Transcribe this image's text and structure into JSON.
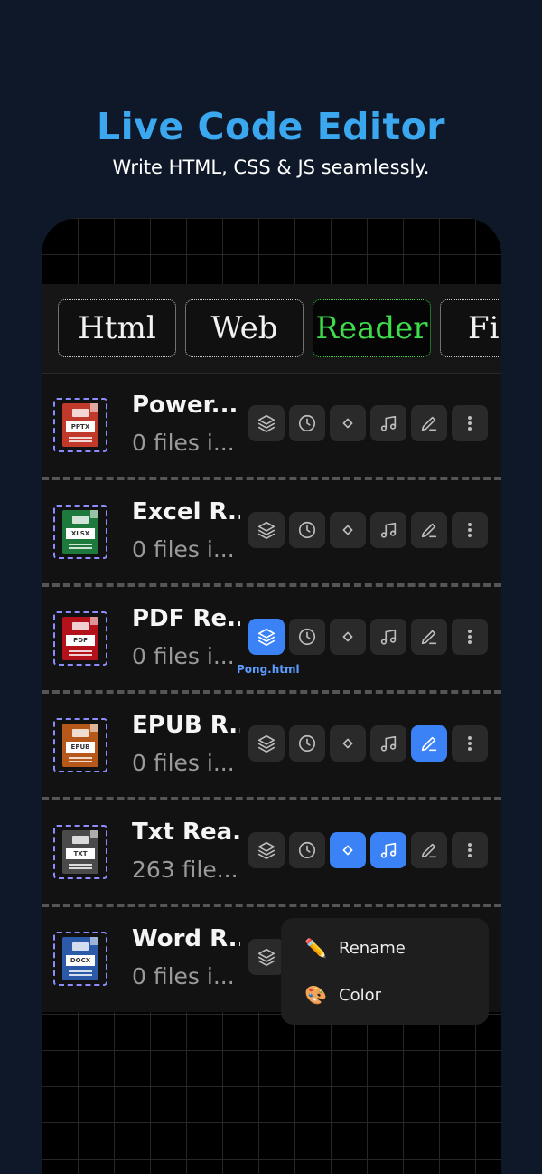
{
  "hero": {
    "title": "Live Code Editor",
    "subtitle": "Write HTML, CSS & JS seamlessly."
  },
  "tabs": [
    {
      "label": "Html",
      "active": false
    },
    {
      "label": "Web",
      "active": false
    },
    {
      "label": "Reader",
      "active": true
    },
    {
      "label": "Fi",
      "active": false
    }
  ],
  "files": [
    {
      "title": "Power...",
      "subtitle": "0 files i...",
      "icon_label": "PPTX",
      "icon_color": "#c0392b",
      "highlighted": []
    },
    {
      "title": "Excel R...",
      "subtitle": "0 files i...",
      "icon_label": "XLSX",
      "icon_color": "#1e7a3c",
      "highlighted": []
    },
    {
      "title": "PDF Re...",
      "subtitle": "0 files i...",
      "icon_label": "PDF",
      "icon_color": "#b3121b",
      "highlighted": [
        "layers"
      ],
      "caption": "Pong.html"
    },
    {
      "title": "EPUB R...",
      "subtitle": "0 files i...",
      "icon_label": "EPUB",
      "icon_color": "#b5581a",
      "highlighted": [
        "edit"
      ]
    },
    {
      "title": "Txt Rea...",
      "subtitle": "263 file...",
      "icon_label": "TXT",
      "icon_color": "#4a4a4a",
      "highlighted": [
        "diamond",
        "music"
      ]
    },
    {
      "title": "Word R...",
      "subtitle": "0 files i...",
      "icon_label": "DOCX",
      "icon_color": "#2b5aa8",
      "highlighted": []
    }
  ],
  "actions": [
    "layers-icon",
    "clock-icon",
    "diamond-icon",
    "music-icon",
    "pencil-icon",
    "more-icon"
  ],
  "context_menu": {
    "items": [
      {
        "emoji": "✏️",
        "label": "Rename"
      },
      {
        "emoji": "🎨",
        "label": "Color"
      }
    ]
  },
  "colors": {
    "accent": "#3aa7ee",
    "active_tab": "#3ddc4a",
    "action_on": "#3b82f6"
  }
}
